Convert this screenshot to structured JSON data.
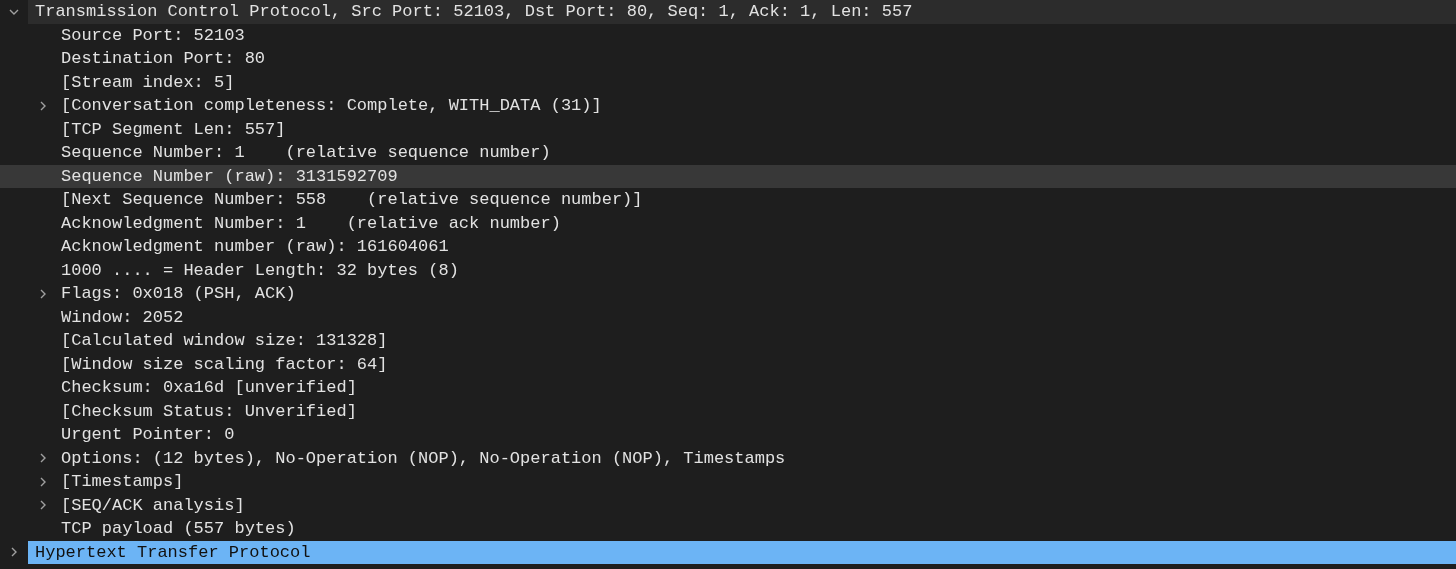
{
  "tree": [
    {
      "label": "Transmission Control Protocol, Src Port: 52103, Dst Port: 80, Seq: 1, Ack: 1, Len: 557",
      "expanded": true,
      "selected": false,
      "highlighted": false,
      "children": [
        {
          "label": "Source Port: 52103",
          "selected": false,
          "highlighted": false
        },
        {
          "label": "Destination Port: 80",
          "selected": false,
          "highlighted": false
        },
        {
          "label": "[Stream index: 5]",
          "selected": false,
          "highlighted": false
        },
        {
          "label": "[Conversation completeness: Complete, WITH_DATA (31)]",
          "expanded": false,
          "selected": false,
          "highlighted": false
        },
        {
          "label": "[TCP Segment Len: 557]",
          "selected": false,
          "highlighted": false
        },
        {
          "label": "Sequence Number: 1    (relative sequence number)",
          "selected": false,
          "highlighted": false
        },
        {
          "label": "Sequence Number (raw): 3131592709",
          "selected": false,
          "highlighted": true
        },
        {
          "label": "[Next Sequence Number: 558    (relative sequence number)]",
          "selected": false,
          "highlighted": false
        },
        {
          "label": "Acknowledgment Number: 1    (relative ack number)",
          "selected": false,
          "highlighted": false
        },
        {
          "label": "Acknowledgment number (raw): 161604061",
          "selected": false,
          "highlighted": false
        },
        {
          "label": "1000 .... = Header Length: 32 bytes (8)",
          "selected": false,
          "highlighted": false
        },
        {
          "label": "Flags: 0x018 (PSH, ACK)",
          "expanded": false,
          "selected": false,
          "highlighted": false
        },
        {
          "label": "Window: 2052",
          "selected": false,
          "highlighted": false
        },
        {
          "label": "[Calculated window size: 131328]",
          "selected": false,
          "highlighted": false
        },
        {
          "label": "[Window size scaling factor: 64]",
          "selected": false,
          "highlighted": false
        },
        {
          "label": "Checksum: 0xa16d [unverified]",
          "selected": false,
          "highlighted": false
        },
        {
          "label": "[Checksum Status: Unverified]",
          "selected": false,
          "highlighted": false
        },
        {
          "label": "Urgent Pointer: 0",
          "selected": false,
          "highlighted": false
        },
        {
          "label": "Options: (12 bytes), No-Operation (NOP), No-Operation (NOP), Timestamps",
          "expanded": false,
          "selected": false,
          "highlighted": false
        },
        {
          "label": "[Timestamps]",
          "expanded": false,
          "selected": false,
          "highlighted": false
        },
        {
          "label": "[SEQ/ACK analysis]",
          "expanded": false,
          "selected": false,
          "highlighted": false
        },
        {
          "label": "TCP payload (557 bytes)",
          "selected": false,
          "highlighted": false
        }
      ]
    },
    {
      "label": "Hypertext Transfer Protocol",
      "expanded": false,
      "selected": true
    }
  ]
}
